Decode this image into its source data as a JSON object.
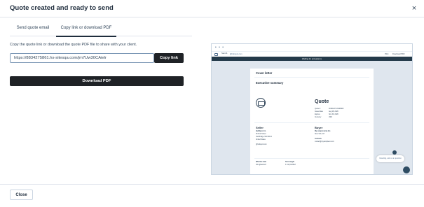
{
  "modal": {
    "title": "Quote created and ready to send",
    "close_icon": "×"
  },
  "tabs": [
    {
      "label": "Send quote email",
      "active": false
    },
    {
      "label": "Copy link or download PDF",
      "active": true
    }
  ],
  "copy_section": {
    "instruction": "Copy the quote link or download the quote PDF file to share with your client.",
    "link_value": "https://8834275861.hs-sitesqa.com/jm7Uw30CAielr",
    "copy_button": "Copy link",
    "download_button": "Download PDF"
  },
  "preview": {
    "dots": "• • •",
    "topbar": {
      "from": "Sent &",
      "email": "@hubspot.com",
      "print": "Print",
      "download": "Download PDF"
    },
    "banner": "Waiting for acceptance",
    "page": {
      "cover_letter": "Cover letter",
      "executive_summary": "Executive summary",
      "quote_title": "Quote",
      "quote_details": [
        {
          "k": "Quote #",
          "v": "20181207-16006908"
        },
        {
          "k": "Issued date",
          "v": "Aug 28, 2020"
        },
        {
          "k": "Expires",
          "v": "Nov 30, 2020"
        },
        {
          "k": "Currency",
          "v": "USD"
        }
      ],
      "seller_heading": "Seller",
      "seller_lines": [
        "HubSpot, Inc.",
        "25 First Street",
        "Cambridge, MA 02141",
        "United States"
      ],
      "seller_email": "@hubspot.com",
      "buyer_heading": "Buyer",
      "buyer_lines": [
        "My sample name Inc.",
        "New York, NY"
      ],
      "contact_label": "Contacts",
      "contact_email": "contact@mysampleco.com",
      "effective_label": "Effective date",
      "effective_value": "1st agreement",
      "term_label": "Term length",
      "term_value": "1 mo provided"
    },
    "chat_bubble": "Greeting, ask us a question"
  },
  "footer": {
    "close_button": "Close"
  }
}
